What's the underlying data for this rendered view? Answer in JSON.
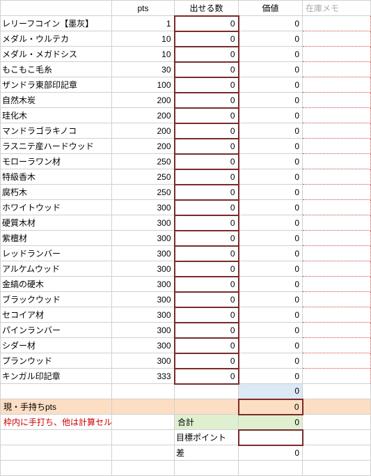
{
  "headers": {
    "c1": "",
    "c2": "pts",
    "c3": "出せる数",
    "c4": "価値",
    "c5": "在庫メモ"
  },
  "rows": [
    {
      "name": "レリーフコイン【墨灰】",
      "pts": 1,
      "put": 0,
      "value": 0
    },
    {
      "name": "メダル・ウルテカ",
      "pts": 10,
      "put": 0,
      "value": 0
    },
    {
      "name": "メダル・メガドシス",
      "pts": 10,
      "put": 0,
      "value": 0
    },
    {
      "name": "もこもこ毛糸",
      "pts": 30,
      "put": 0,
      "value": 0
    },
    {
      "name": "ザンドラ東部印記章",
      "pts": 100,
      "put": 0,
      "value": 0
    },
    {
      "name": "自然木炭",
      "pts": 200,
      "put": 0,
      "value": 0
    },
    {
      "name": "珪化木",
      "pts": 200,
      "put": 0,
      "value": 0
    },
    {
      "name": "マンドラゴラキノコ",
      "pts": 200,
      "put": 0,
      "value": 0
    },
    {
      "name": "ラスニテ産ハードウッド",
      "pts": 200,
      "put": 0,
      "value": 0
    },
    {
      "name": "モローラワン材",
      "pts": 250,
      "put": 0,
      "value": 0
    },
    {
      "name": "特級香木",
      "pts": 250,
      "put": 0,
      "value": 0
    },
    {
      "name": "腐朽木",
      "pts": 250,
      "put": 0,
      "value": 0
    },
    {
      "name": "ホワイトウッド",
      "pts": 300,
      "put": 0,
      "value": 0
    },
    {
      "name": "硬質木材",
      "pts": 300,
      "put": 0,
      "value": 0
    },
    {
      "name": "紫檀材",
      "pts": 300,
      "put": 0,
      "value": 0
    },
    {
      "name": "レッドランバー",
      "pts": 300,
      "put": 0,
      "value": 0
    },
    {
      "name": "アルケムウッド",
      "pts": 300,
      "put": 0,
      "value": 0
    },
    {
      "name": "金縞の硬木",
      "pts": 300,
      "put": 0,
      "value": 0
    },
    {
      "name": "ブラックウッド",
      "pts": 300,
      "put": 0,
      "value": 0
    },
    {
      "name": "セコイア材",
      "pts": 300,
      "put": 0,
      "value": 0
    },
    {
      "name": "パインランバー",
      "pts": 300,
      "put": 0,
      "value": 0
    },
    {
      "name": "シダー材",
      "pts": 300,
      "put": 0,
      "value": 0
    },
    {
      "name": "プランウッド",
      "pts": 300,
      "put": 0,
      "value": 0
    },
    {
      "name": "キンガル印記章",
      "pts": 333,
      "put": 0,
      "value": 0
    }
  ],
  "summary": {
    "sum_value": 0,
    "current_pts_label": "現・手持ちpts",
    "current_pts_value": 0,
    "note": "枠内に手打ち、他は計算セル",
    "total_label": "合計",
    "total_value": 0,
    "target_label": "目標ポイント",
    "target_value": "",
    "diff_label": "差",
    "diff_value": 0
  }
}
